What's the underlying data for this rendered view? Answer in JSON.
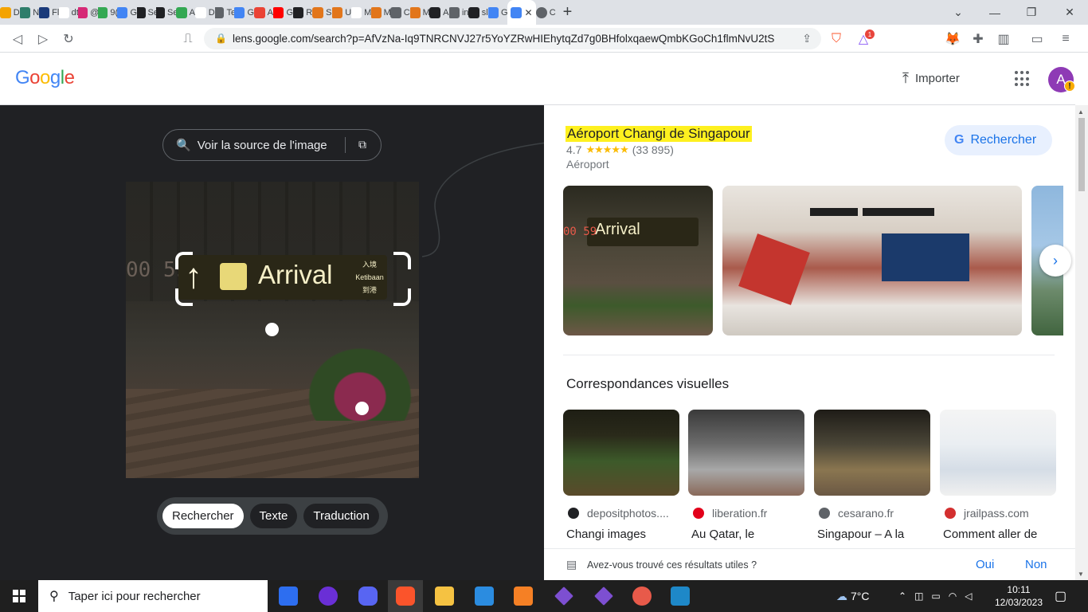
{
  "browser": {
    "tabs": [
      {
        "label": "D",
        "color": "#f4a300"
      },
      {
        "label": "N",
        "color": "#2e7d6b"
      },
      {
        "label": "Fl",
        "color": "#1a3a7a"
      },
      {
        "label": "dt",
        "color": "#ffffff"
      },
      {
        "label": "@",
        "color": "#d62976"
      },
      {
        "label": "9(",
        "color": "#34a853"
      },
      {
        "label": "G",
        "color": "#4285f4"
      },
      {
        "label": "Se",
        "color": "#202124"
      },
      {
        "label": "Se",
        "color": "#202124"
      },
      {
        "label": "A",
        "color": "#34a853"
      },
      {
        "label": "D",
        "color": "#ffffff"
      },
      {
        "label": "Te",
        "color": "#5f6368"
      },
      {
        "label": "G",
        "color": "#4285f4"
      },
      {
        "label": "A",
        "color": "#ea4335"
      },
      {
        "label": "G",
        "color": "#ff0000"
      },
      {
        "label": "R",
        "color": "#202124"
      },
      {
        "label": "S",
        "color": "#e2761b"
      },
      {
        "label": "U",
        "color": "#e2761b"
      },
      {
        "label": "M",
        "color": "#ffffff"
      },
      {
        "label": "M",
        "color": "#e2761b"
      },
      {
        "label": "C",
        "color": "#5f6368"
      },
      {
        "label": "M",
        "color": "#e2761b"
      },
      {
        "label": "A",
        "color": "#202124"
      },
      {
        "label": "in",
        "color": "#5f6368"
      },
      {
        "label": "sl",
        "color": "#202124"
      },
      {
        "label": "G",
        "color": "#4285f4"
      }
    ],
    "active_tab_close": "✕",
    "last_tab": "C",
    "new_tab": "+",
    "url": "lens.google.com/search?p=AfVzNa-Iq9TNRCNVJ27r5YoYZRwHIEhytqZd7g0BHfolxqaewQmbKGoCh1flmNvU2tS...",
    "brave_badge": "1"
  },
  "header": {
    "logo_letters": [
      "G",
      "o",
      "o",
      "g",
      "l",
      "e"
    ],
    "importer_label": "Importer",
    "avatar_letter": "A",
    "avatar_warning": "!"
  },
  "lens": {
    "source_button": "Voir la source de l'image",
    "photo": {
      "clock": "00 59",
      "sign_text": "Arrival",
      "sign_side": [
        "入境",
        "Ketibaan",
        "到港"
      ]
    },
    "modes": [
      {
        "label": "Rechercher",
        "active": true
      },
      {
        "label": "Texte",
        "active": false
      },
      {
        "label": "Traduction",
        "active": false
      }
    ]
  },
  "results": {
    "place_title": "Aéroport Changi de Singapour",
    "rating_value": "4.7",
    "rating_stars": "★★★★★",
    "rating_count": "(33 895)",
    "category": "Aéroport",
    "search_button": "Rechercher",
    "section_title": "Correspondances visuelles",
    "visual_matches": [
      {
        "source": "depositphotos....",
        "title": "Changi images",
        "fav_color": "#202124"
      },
      {
        "source": "liberation.fr",
        "title": "Au Qatar, le",
        "fav_color": "#e2001a"
      },
      {
        "source": "cesarano.fr",
        "title": "Singapour – A la",
        "fav_color": "#5f6368"
      },
      {
        "source": "jrailpass.com",
        "title": "Comment aller de",
        "fav_color": "#d32f2f"
      }
    ],
    "feedback_question": "Avez-vous trouvé ces résultats utiles ?",
    "feedback_yes": "Oui",
    "feedback_no": "Non"
  },
  "taskbar": {
    "search_placeholder": "Taper ici pour rechercher",
    "weather": "7°C",
    "time": "10:11",
    "date": "12/03/2023"
  }
}
